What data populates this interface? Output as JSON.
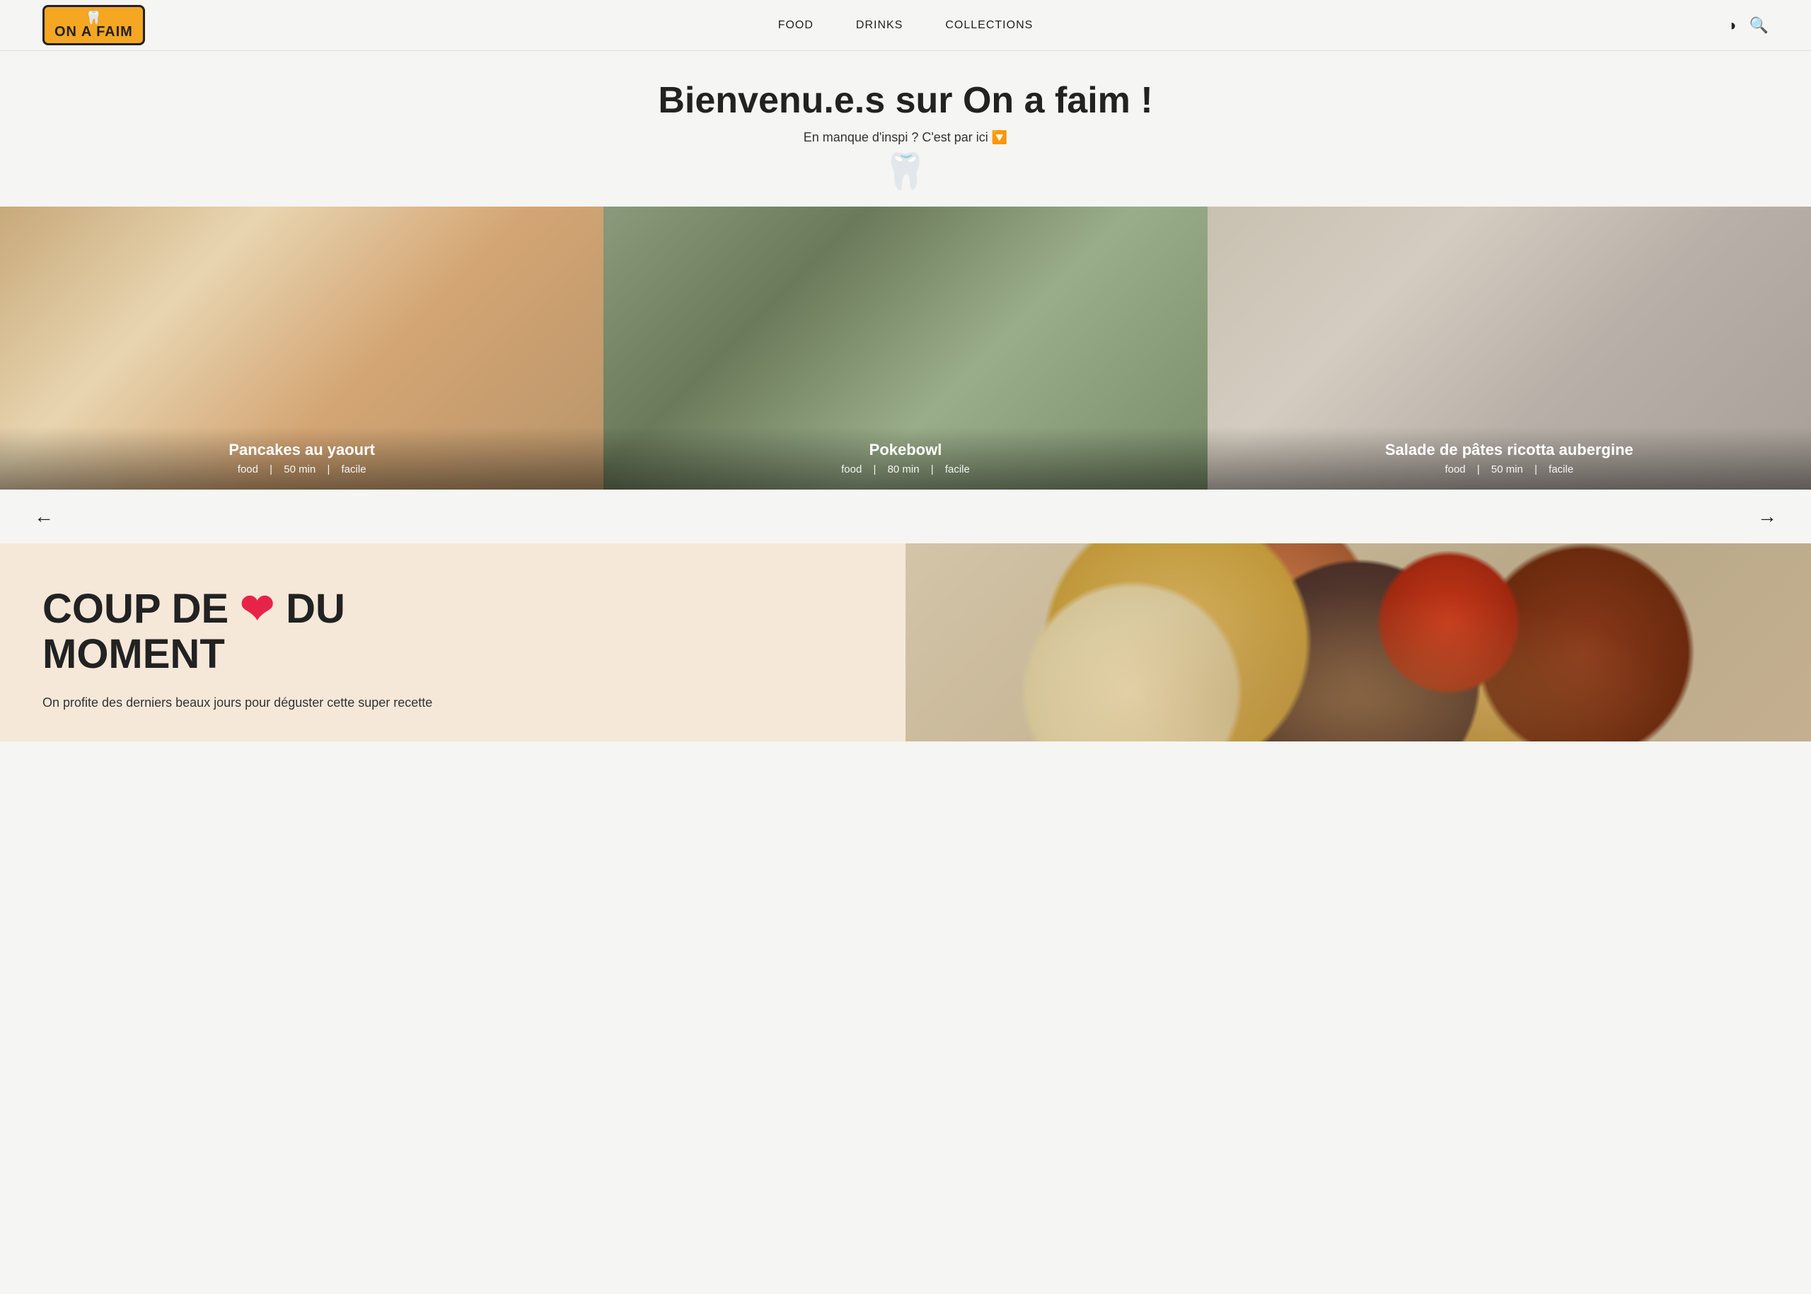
{
  "nav": {
    "logo_line1": "🦷",
    "logo_text": "ON A FAIM",
    "links": [
      {
        "label": "FOOD",
        "href": "#"
      },
      {
        "label": "DRINKS",
        "href": "#"
      },
      {
        "label": "COLLECTIONS",
        "href": "#"
      }
    ],
    "theme_icon": "◑",
    "search_icon": "🔍"
  },
  "hero": {
    "title": "Bienvenu.e.s sur On a faim !",
    "subtitle": "En manque d'inspi ? C'est par ici 🔽",
    "monster_emoji": "🦷"
  },
  "carousel": {
    "items": [
      {
        "title": "Pancakes au yaourt",
        "category": "food",
        "time": "50 min",
        "difficulty": "facile"
      },
      {
        "title": "Pokebowl",
        "category": "food",
        "time": "80 min",
        "difficulty": "facile"
      },
      {
        "title": "Salade de pâtes ricotta aubergine",
        "category": "food",
        "time": "50 min",
        "difficulty": "facile"
      }
    ],
    "prev_label": "←",
    "next_label": "→"
  },
  "coup_de_coeur": {
    "title_line1": "COUP DE",
    "heart": "❤",
    "title_line2": "DU MOMENT",
    "description": "On profite des derniers beaux jours pour déguster cette super recette"
  }
}
